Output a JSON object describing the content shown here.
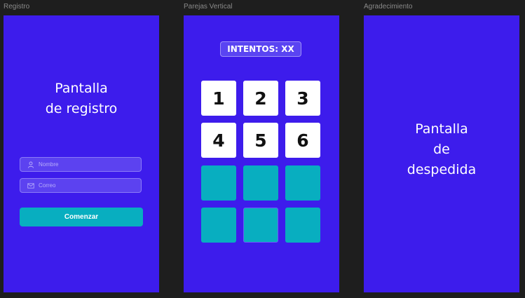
{
  "frames": {
    "registro": {
      "label": "Registro",
      "title_lines": [
        "Pantalla",
        "de registro"
      ],
      "name_field": {
        "placeholder": "Nombre",
        "icon": "user-icon"
      },
      "email_field": {
        "placeholder": "Correo",
        "icon": "mail-icon"
      },
      "start_button": "Comenzar"
    },
    "parejas": {
      "label": "Parejas Vertical",
      "attempts_label": "INTENTOS: XX",
      "cards": [
        {
          "value": "1",
          "state": "up"
        },
        {
          "value": "2",
          "state": "up"
        },
        {
          "value": "3",
          "state": "up"
        },
        {
          "value": "4",
          "state": "up"
        },
        {
          "value": "5",
          "state": "up"
        },
        {
          "value": "6",
          "state": "up"
        },
        {
          "value": "",
          "state": "down"
        },
        {
          "value": "",
          "state": "down"
        },
        {
          "value": "",
          "state": "down"
        },
        {
          "value": "",
          "state": "down"
        },
        {
          "value": "",
          "state": "down"
        },
        {
          "value": "",
          "state": "down"
        }
      ]
    },
    "agradecimiento": {
      "label": "Agradecimiento",
      "title_lines": [
        "Pantalla",
        "de",
        "despedida"
      ]
    }
  },
  "colors": {
    "frame_bg": "#3d1cec",
    "accent": "#08aec0",
    "canvas_bg": "#1e1e1e"
  }
}
